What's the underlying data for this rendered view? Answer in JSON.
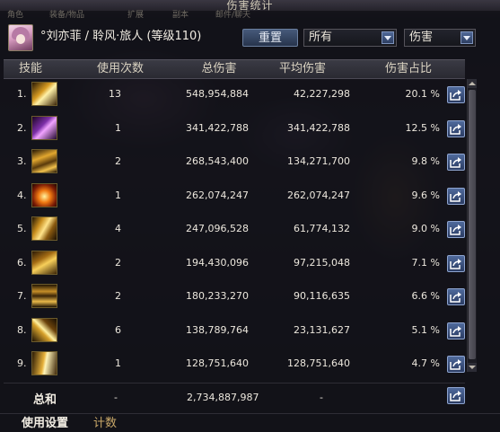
{
  "window": {
    "title": "伤害统计"
  },
  "background_menu": [
    "角色",
    "装备/物品",
    "扩展",
    "副本",
    "邮件/聊天"
  ],
  "header": {
    "character_label": "°刘亦菲 / 聆风·旅人 (等级110)",
    "reset_button": "重置",
    "filter_select": {
      "selected": "所有"
    },
    "metric_select": {
      "selected": "伤害"
    }
  },
  "table": {
    "columns": [
      "技能",
      "使用次数",
      "总伤害",
      "平均伤害",
      "伤害占比"
    ],
    "rows": [
      {
        "index": "1.",
        "uses": "13",
        "total": "548,954,884",
        "average": "42,227,298",
        "share": "20.1 %"
      },
      {
        "index": "2.",
        "uses": "1",
        "total": "341,422,788",
        "average": "341,422,788",
        "share": "12.5 %"
      },
      {
        "index": "3.",
        "uses": "2",
        "total": "268,543,400",
        "average": "134,271,700",
        "share": "9.8 %"
      },
      {
        "index": "4.",
        "uses": "1",
        "total": "262,074,247",
        "average": "262,074,247",
        "share": "9.6 %"
      },
      {
        "index": "5.",
        "uses": "4",
        "total": "247,096,528",
        "average": "61,774,132",
        "share": "9.0 %"
      },
      {
        "index": "6.",
        "uses": "2",
        "total": "194,430,096",
        "average": "97,215,048",
        "share": "7.1 %"
      },
      {
        "index": "7.",
        "uses": "2",
        "total": "180,233,270",
        "average": "90,116,635",
        "share": "6.6 %"
      },
      {
        "index": "8.",
        "uses": "6",
        "total": "138,789,764",
        "average": "23,131,627",
        "share": "5.1 %"
      },
      {
        "index": "9.",
        "uses": "1",
        "total": "128,751,640",
        "average": "128,751,640",
        "share": "4.7 %"
      }
    ],
    "skill_icons": [
      "skill-icon-gold-slash",
      "skill-icon-purple-arc",
      "skill-icon-gold-wind",
      "skill-icon-fire-burst",
      "skill-icon-gold-burst",
      "skill-icon-gold-claw",
      "skill-icon-gold-gate",
      "skill-icon-gold-rune",
      "skill-icon-gold-blade"
    ]
  },
  "total": {
    "label": "总和",
    "uses": "-",
    "total": "2,734,887,987",
    "average": "-"
  },
  "tabs": [
    "使用设置",
    "计数"
  ],
  "colors": {
    "panel": "#101016",
    "header_bar": "#2a2a32",
    "button_blue": "#2b3c63",
    "accent_gold": "#e3b33a"
  }
}
